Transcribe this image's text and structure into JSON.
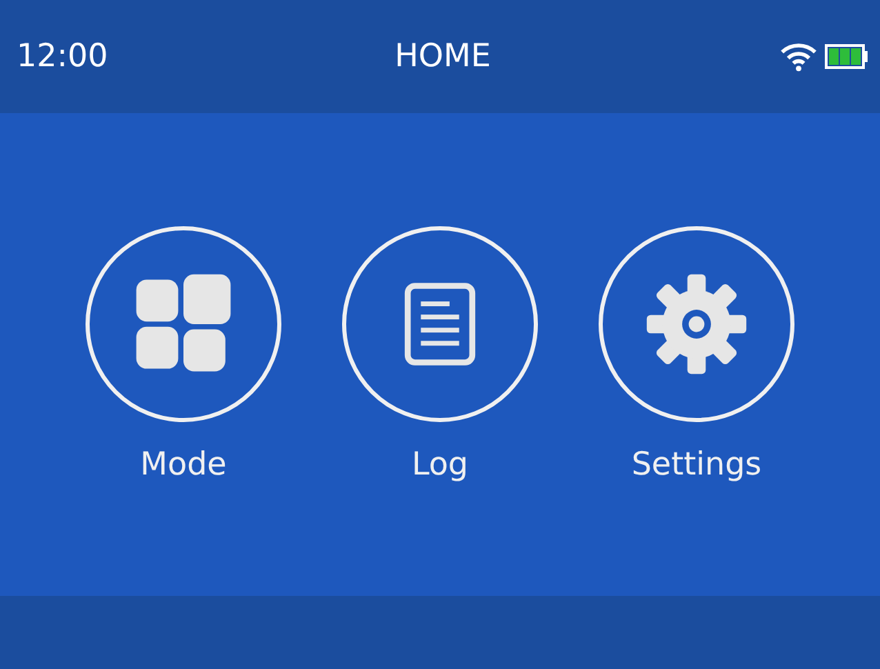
{
  "status_bar": {
    "time": "12:00",
    "title": "HOME"
  },
  "menu": [
    {
      "kind": "mode",
      "label": "Mode"
    },
    {
      "kind": "log",
      "label": "Log"
    },
    {
      "kind": "settings",
      "label": "Settings"
    }
  ]
}
